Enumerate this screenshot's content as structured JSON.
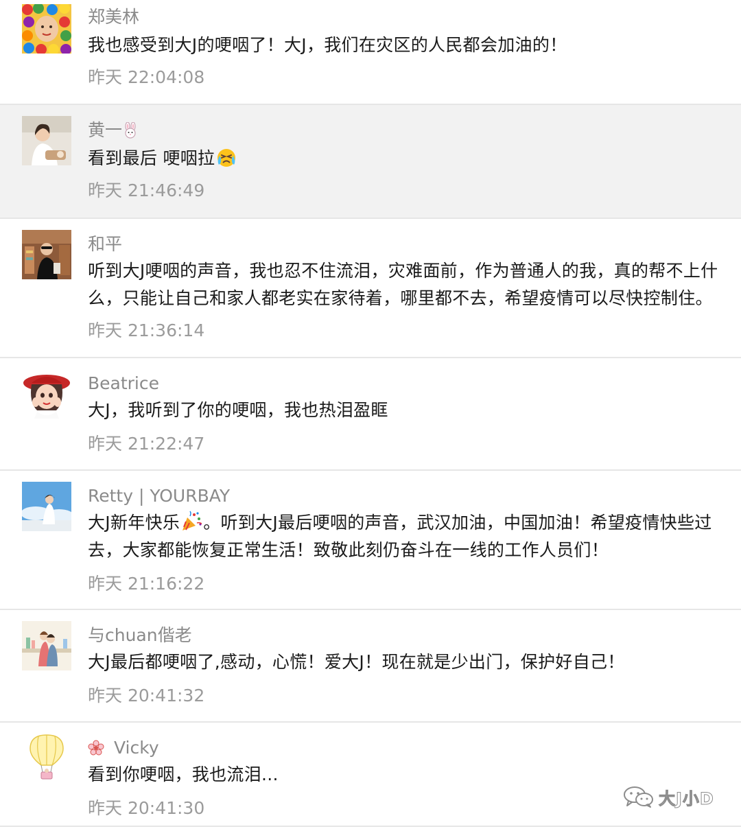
{
  "comments": [
    {
      "name": "郑美林",
      "text": "我也感受到大J的哽咽了！大J，我们在灾区的人民都会加油的！",
      "time": "昨天 22:04:08"
    },
    {
      "name": "黄一",
      "name_icon": "rabbit-emoji",
      "text": "看到最后 哽咽拉",
      "text_emoji": "crying-face-emoji",
      "time": "昨天 21:46:49"
    },
    {
      "name": "和平",
      "text": "听到大J哽咽的声音，我也忍不住流泪，灾难面前，作为普通人的我，真的帮不上什么，只能让自己和家人都老实在家待着，哪里都不去，希望疫情可以尽快控制住。",
      "time": "昨天 21:36:14"
    },
    {
      "name": "Beatrice",
      "text": "大J，我听到了你的哽咽，我也热泪盈眶",
      "time": "昨天 21:22:47"
    },
    {
      "name": "Retty | YOURBAY",
      "text_before_emoji": "大J新年快乐",
      "text_emoji": "party-popper-emoji",
      "text_after_emoji": "。听到大J最后哽咽的声音，武汉加油，中国加油！希望疫情快些过去，大家都能恢复正常生活！致敬此刻仍奋斗在一线的工作人员们！",
      "time": "昨天 21:16:22"
    },
    {
      "name": "与chuan偕老",
      "text": "大J最后都哽咽了,感动，心慌！爱大J！现在就是少出门，保护好自己！",
      "time": "昨天 20:41:32"
    },
    {
      "name": "Vicky",
      "name_icon": "flower-icon",
      "text": "看到你哽咽，我也流泪...",
      "time": "昨天 20:41:30"
    }
  ],
  "watermark": {
    "icon": "wechat-icon",
    "text": "大J小D"
  },
  "colors": {
    "name": "#8a8a8a",
    "text": "#1a1a1a",
    "time": "#9b9b9b",
    "highlight_bg": "#f2f2f2",
    "divider": "#e6e6e6"
  }
}
